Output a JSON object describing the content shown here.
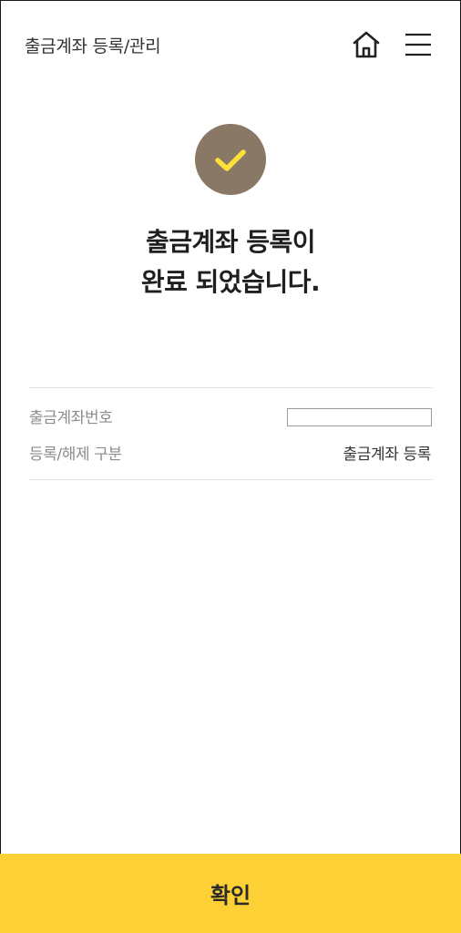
{
  "header": {
    "title": "출금계좌 등록/관리",
    "home_icon": "home-icon",
    "menu_icon": "hamburger-menu-icon"
  },
  "status": {
    "icon": "check-icon",
    "badge_color": "#8a7866",
    "check_color": "#fde13a",
    "message_line1": "출금계좌 등록이",
    "message_line2": "완료 되었습니다."
  },
  "details": {
    "rows": [
      {
        "label": "출금계좌번호",
        "value": ""
      },
      {
        "label": "등록/해제 구분",
        "value": "출금계좌 등록"
      }
    ]
  },
  "footer": {
    "confirm_label": "확인",
    "button_color": "#fdd135"
  }
}
